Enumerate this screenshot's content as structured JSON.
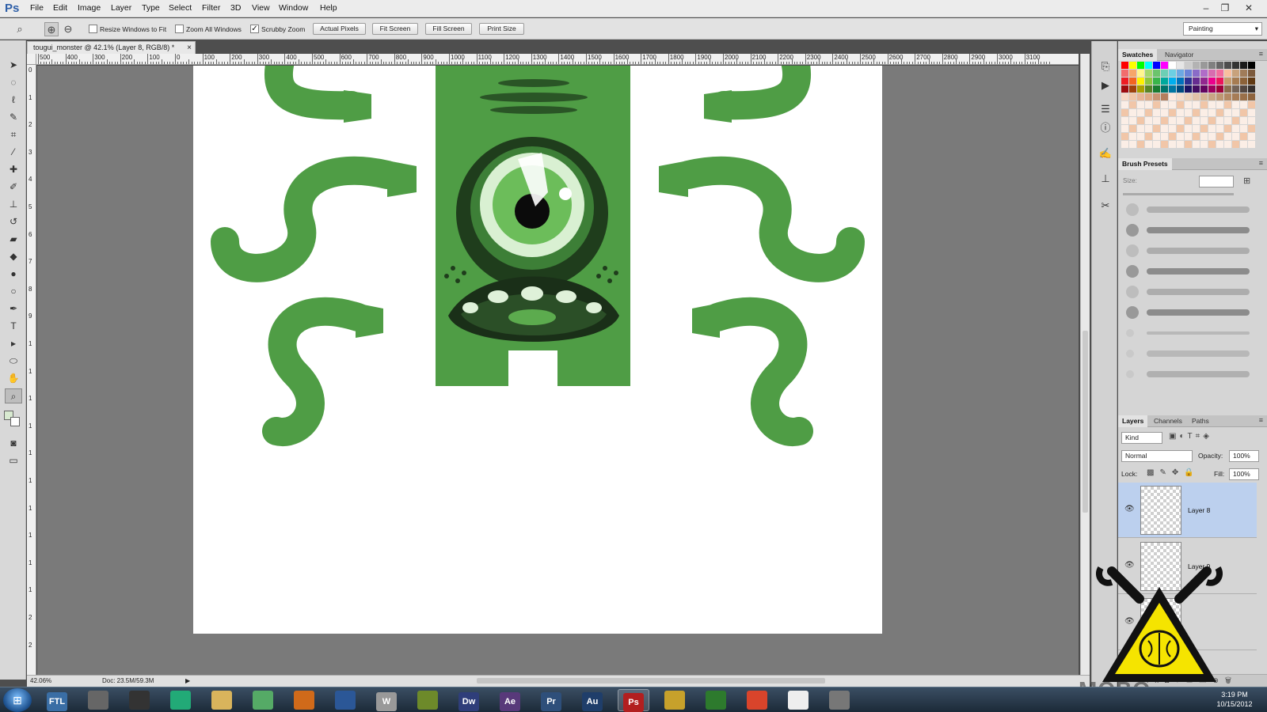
{
  "app": {
    "logo": "Ps",
    "menus": [
      "File",
      "Edit",
      "Image",
      "Layer",
      "Type",
      "Select",
      "Filter",
      "3D",
      "View",
      "Window",
      "Help"
    ],
    "window_controls": [
      "minimize-icon",
      "restore-icon",
      "close-icon"
    ]
  },
  "options_bar": {
    "tool_icon": "zoom-icon",
    "zoom_in_icon": "zoom-in-icon",
    "zoom_out_icon": "zoom-out-icon",
    "checks": [
      {
        "label": "Resize Windows to Fit",
        "checked": false
      },
      {
        "label": "Zoom All Windows",
        "checked": false
      },
      {
        "label": "Scrubby Zoom",
        "checked": true
      }
    ],
    "buttons": [
      "Actual Pixels",
      "Fit Screen",
      "Fill Screen",
      "Print Size"
    ],
    "workspace": "Painting"
  },
  "tools": [
    "move-icon",
    "marquee-icon",
    "lasso-icon",
    "quick-select-icon",
    "crop-icon",
    "eyedropper-icon",
    "spot-heal-icon",
    "brush-icon",
    "clone-stamp-icon",
    "history-brush-icon",
    "eraser-icon",
    "paint-bucket-icon",
    "blur-icon",
    "dodge-icon",
    "pen-icon",
    "type-icon",
    "path-select-icon",
    "ellipse-shape-icon",
    "hand-icon",
    "zoom-icon"
  ],
  "document": {
    "tab_title": "tougui_monster @ 42.1% (Layer 8, RGB/8) *",
    "close_glyph": "×",
    "hruler_labels": [
      "500",
      "400",
      "300",
      "200",
      "100",
      "0",
      "100",
      "200",
      "300",
      "400",
      "500",
      "600",
      "700",
      "800",
      "900",
      "1000",
      "1100",
      "1200",
      "1300",
      "1400",
      "1500",
      "1600",
      "1700",
      "1800",
      "1900",
      "2000",
      "2100",
      "2200",
      "2300",
      "2400",
      "2500",
      "2600",
      "2700",
      "2800",
      "2900",
      "3000",
      "3100"
    ],
    "vruler_labels": [
      "0",
      "1",
      "2",
      "3",
      "4",
      "5",
      "6",
      "7",
      "8",
      "9",
      "1",
      "1",
      "1",
      "1",
      "1",
      "1",
      "1",
      "1",
      "1",
      "1",
      "2",
      "2"
    ],
    "artwork_colors": {
      "body": "#4f9d45",
      "dark": "#1f3d1c",
      "eye_outer": "#d9f0d2",
      "iris": "#6cbd5a",
      "pupil": "#0b0b0b",
      "teeth": "#dff1d9",
      "mouth": "#1a2f18"
    }
  },
  "status": {
    "zoom": "42.06%",
    "doc": "Doc: 23.5M/59.3M"
  },
  "panels": {
    "swatch_tabs": [
      "Swatches",
      "Navigator"
    ],
    "brush_tab": "Brush Presets",
    "brush_size_label": "Size:",
    "layer_tabs": [
      "Layers",
      "Channels",
      "Paths"
    ],
    "kind": "Kind",
    "blend_mode": "Normal",
    "opacity_label": "Opacity:",
    "opacity_value": "100%",
    "lock_label": "Lock:",
    "fill_label": "Fill:",
    "fill_value": "100%",
    "layers": [
      {
        "name": "Layer 8",
        "selected": true
      },
      {
        "name": "Layer 9",
        "selected": false
      },
      {
        "name": "",
        "selected": false
      }
    ]
  },
  "taskbar": {
    "apps": [
      "FTL",
      "",
      "",
      "",
      "",
      "",
      "",
      "",
      "W",
      "",
      "Dw",
      "Ae",
      "Pr",
      "Au",
      "Ps",
      "",
      "",
      "",
      "",
      ""
    ],
    "clock_time": "3:19 PM",
    "clock_date": "10/15/2012"
  },
  "watermark": "MOBO"
}
